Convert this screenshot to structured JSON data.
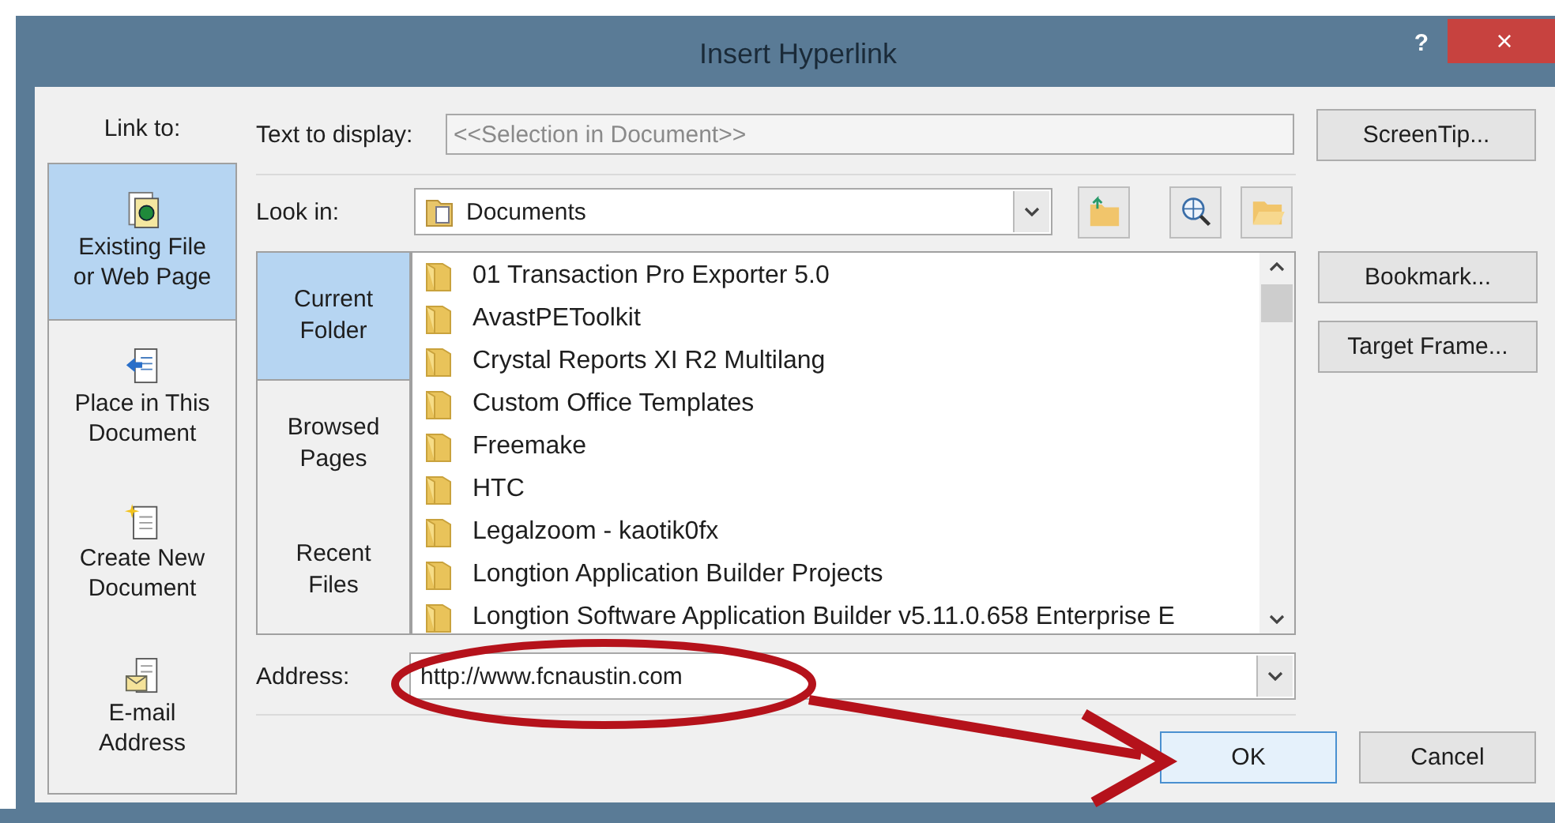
{
  "window": {
    "title": "Insert Hyperlink",
    "help": "?",
    "close": "×"
  },
  "link_to": {
    "label": "Link to:",
    "items": [
      {
        "label": "Existing File or Web Page",
        "kind": "file",
        "selected": true
      },
      {
        "label": "Place in This Document",
        "kind": "place",
        "selected": false
      },
      {
        "label": "Create New Document",
        "kind": "new",
        "selected": false
      },
      {
        "label": "E-mail Address",
        "kind": "email",
        "selected": false
      }
    ]
  },
  "text_to_display": {
    "label": "Text to display:",
    "value": "<<Selection in Document>>",
    "disabled": true
  },
  "screentip_button": "ScreenTip...",
  "look_in": {
    "label": "Look in:",
    "value": "Documents"
  },
  "browse_tabs": [
    {
      "label": "Current Folder",
      "selected": true
    },
    {
      "label": "Browsed Pages",
      "selected": false
    },
    {
      "label": "Recent Files",
      "selected": false
    }
  ],
  "files": [
    "01 Transaction Pro Exporter 5.0",
    "AvastPEToolkit",
    "Crystal Reports XI R2 Multilang",
    "Custom Office Templates",
    "Freemake",
    "HTC",
    "Legalzoom - kaotik0fx",
    "Longtion Application Builder Projects",
    "Longtion Software Application Builder v5.11.0.658 Enterprise E"
  ],
  "side_buttons": [
    "Bookmark...",
    "Target Frame..."
  ],
  "address": {
    "label": "Address:",
    "value": "http://www.fcnaustin.com"
  },
  "buttons": [
    {
      "label": "OK",
      "default": true
    },
    {
      "label": "Cancel",
      "default": false
    }
  ]
}
